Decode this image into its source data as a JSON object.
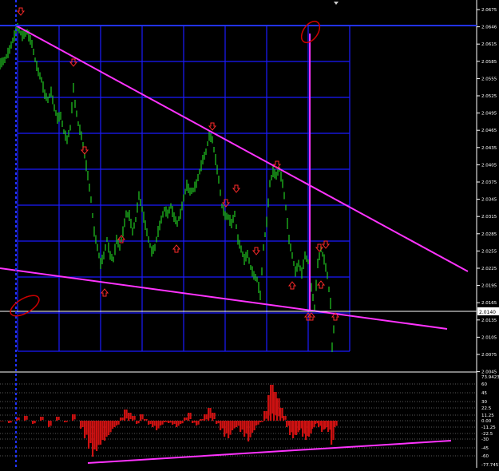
{
  "colors": {
    "background": "#000000",
    "grid": "#1a1aff",
    "candles": "#22cc22",
    "trendline": "#ff33ff",
    "arrows": "#ff2a2a",
    "histogram": "#cc1111",
    "text": "#ffffff",
    "marker": "#cc0000"
  },
  "main_axis": {
    "labels": [
      "2.0675",
      "2.0646",
      "2.0615",
      "2.0585",
      "2.0555",
      "2.0525",
      "2.0495",
      "2.0465",
      "2.0435",
      "2.0405",
      "2.0375",
      "2.0345",
      "2.0315",
      "2.0285",
      "2.0255",
      "2.0225",
      "2.0195",
      "2.0165",
      "2.0135",
      "2.0105",
      "2.0075",
      "2.0045"
    ],
    "price_tag": "2.0140"
  },
  "indicator_axis": {
    "labels": [
      "73.9423",
      "60",
      "45",
      "30",
      "22.5",
      "11.25",
      "0.00",
      "-11.25",
      "-22.5",
      "-30",
      "-45",
      "-60",
      "-77.7451"
    ]
  },
  "arrows": [
    {
      "dir": "down"
    },
    {
      "dir": "down"
    },
    {
      "dir": "down"
    },
    {
      "dir": "down"
    },
    {
      "dir": "down"
    },
    {
      "dir": "down"
    },
    {
      "dir": "down"
    },
    {
      "dir": "down"
    },
    {
      "dir": "down"
    },
    {
      "dir": "down"
    },
    {
      "dir": "up"
    },
    {
      "dir": "up"
    },
    {
      "dir": "up"
    },
    {
      "dir": "up"
    },
    {
      "dir": "up"
    },
    {
      "dir": "up"
    },
    {
      "dir": "up"
    },
    {
      "dir": "up"
    }
  ]
}
